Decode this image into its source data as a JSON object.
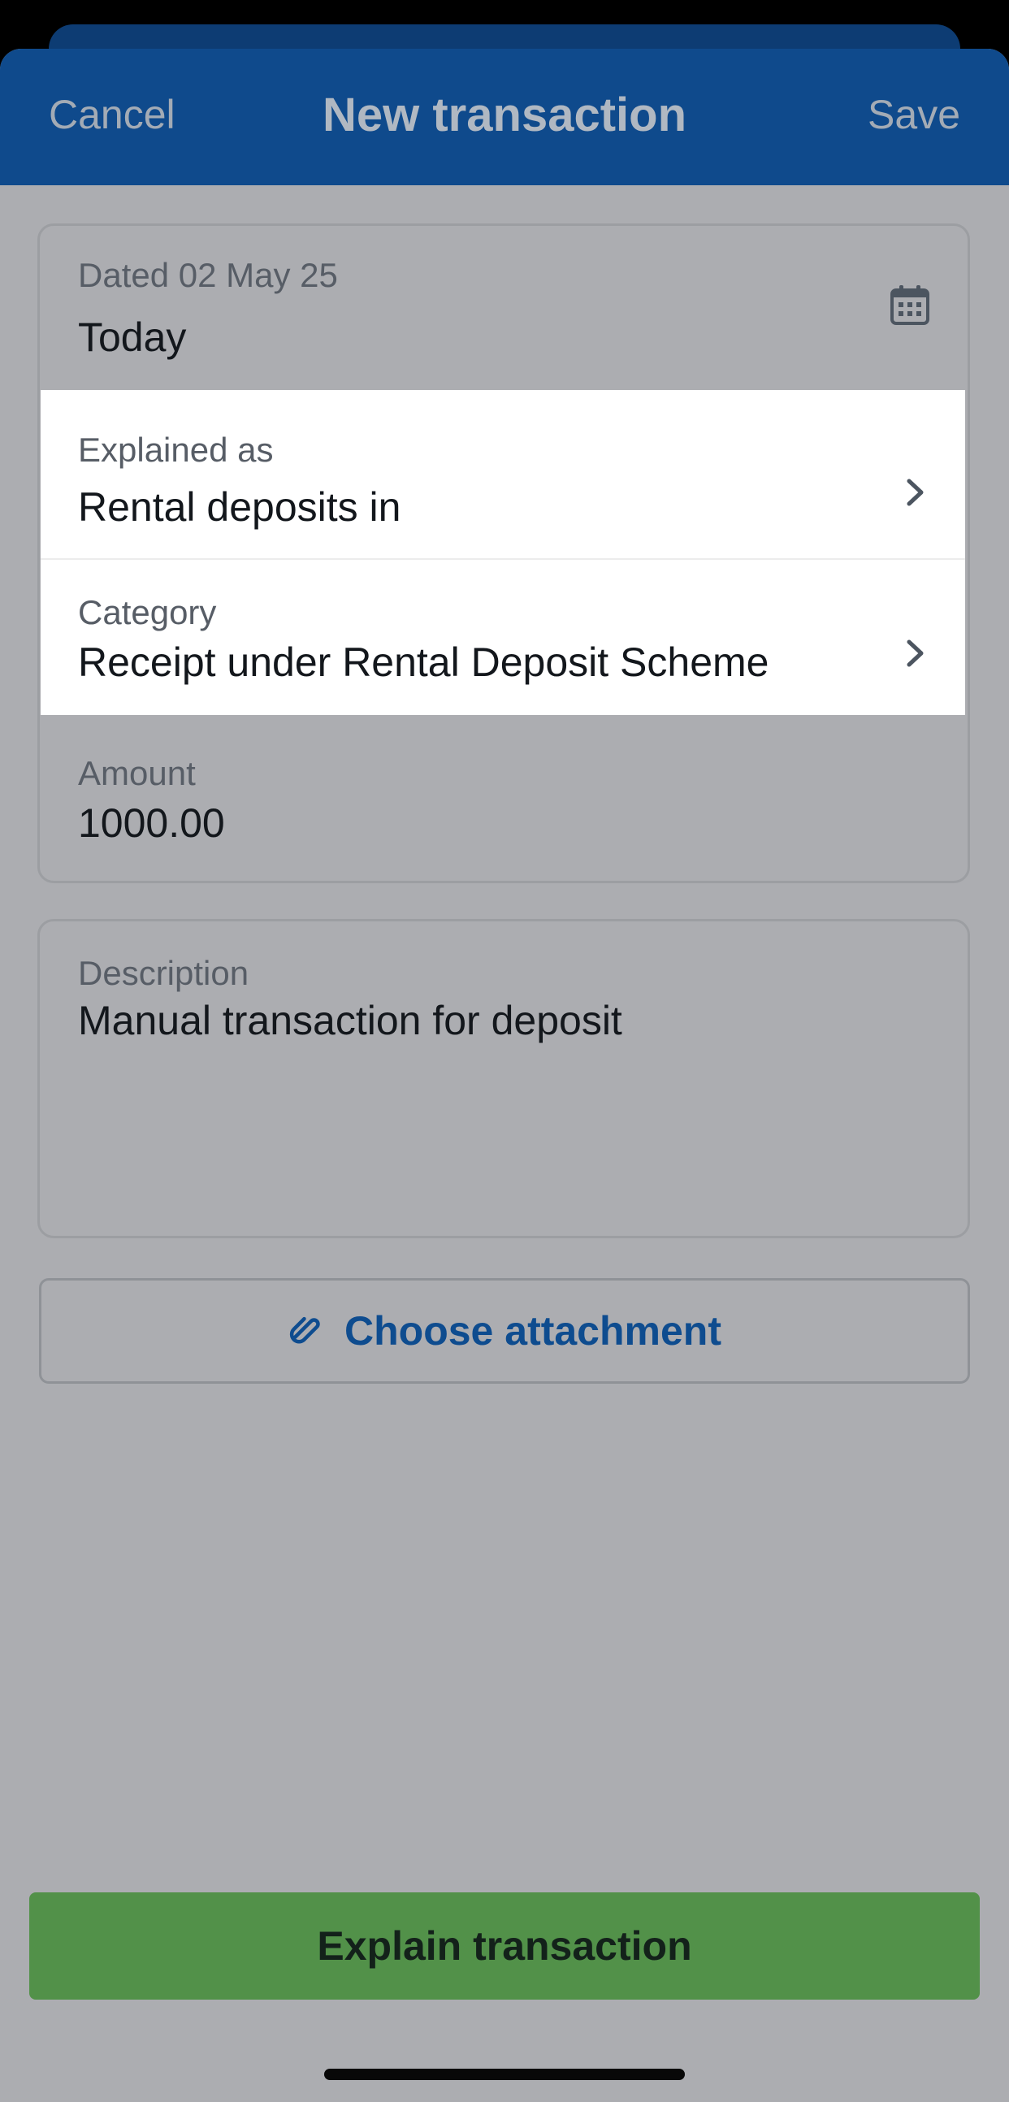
{
  "navbar": {
    "cancel_label": "Cancel",
    "title": "New transaction",
    "save_label": "Save"
  },
  "form": {
    "date": {
      "label": "Dated 02 May 25",
      "value": "Today",
      "icon": "calendar-icon"
    },
    "explained_as": {
      "label": "Explained as",
      "value": "Rental deposits in",
      "icon": "chevron-right-icon"
    },
    "category": {
      "label": "Category",
      "value": "Receipt under Rental Deposit Scheme",
      "icon": "chevron-right-icon"
    },
    "amount": {
      "label": "Amount",
      "value": "1000.00"
    },
    "description": {
      "label": "Description",
      "value": "Manual transaction for deposit"
    }
  },
  "attachment": {
    "label": "Choose attachment",
    "icon": "paperclip-icon"
  },
  "explain": {
    "label": "Explain transaction"
  },
  "colors": {
    "navbar": "#0f4a8c",
    "accent": "#0e4c8f",
    "primary_button": "#529149",
    "overlay_background": "#acadb1",
    "highlight": "#ffffff"
  }
}
